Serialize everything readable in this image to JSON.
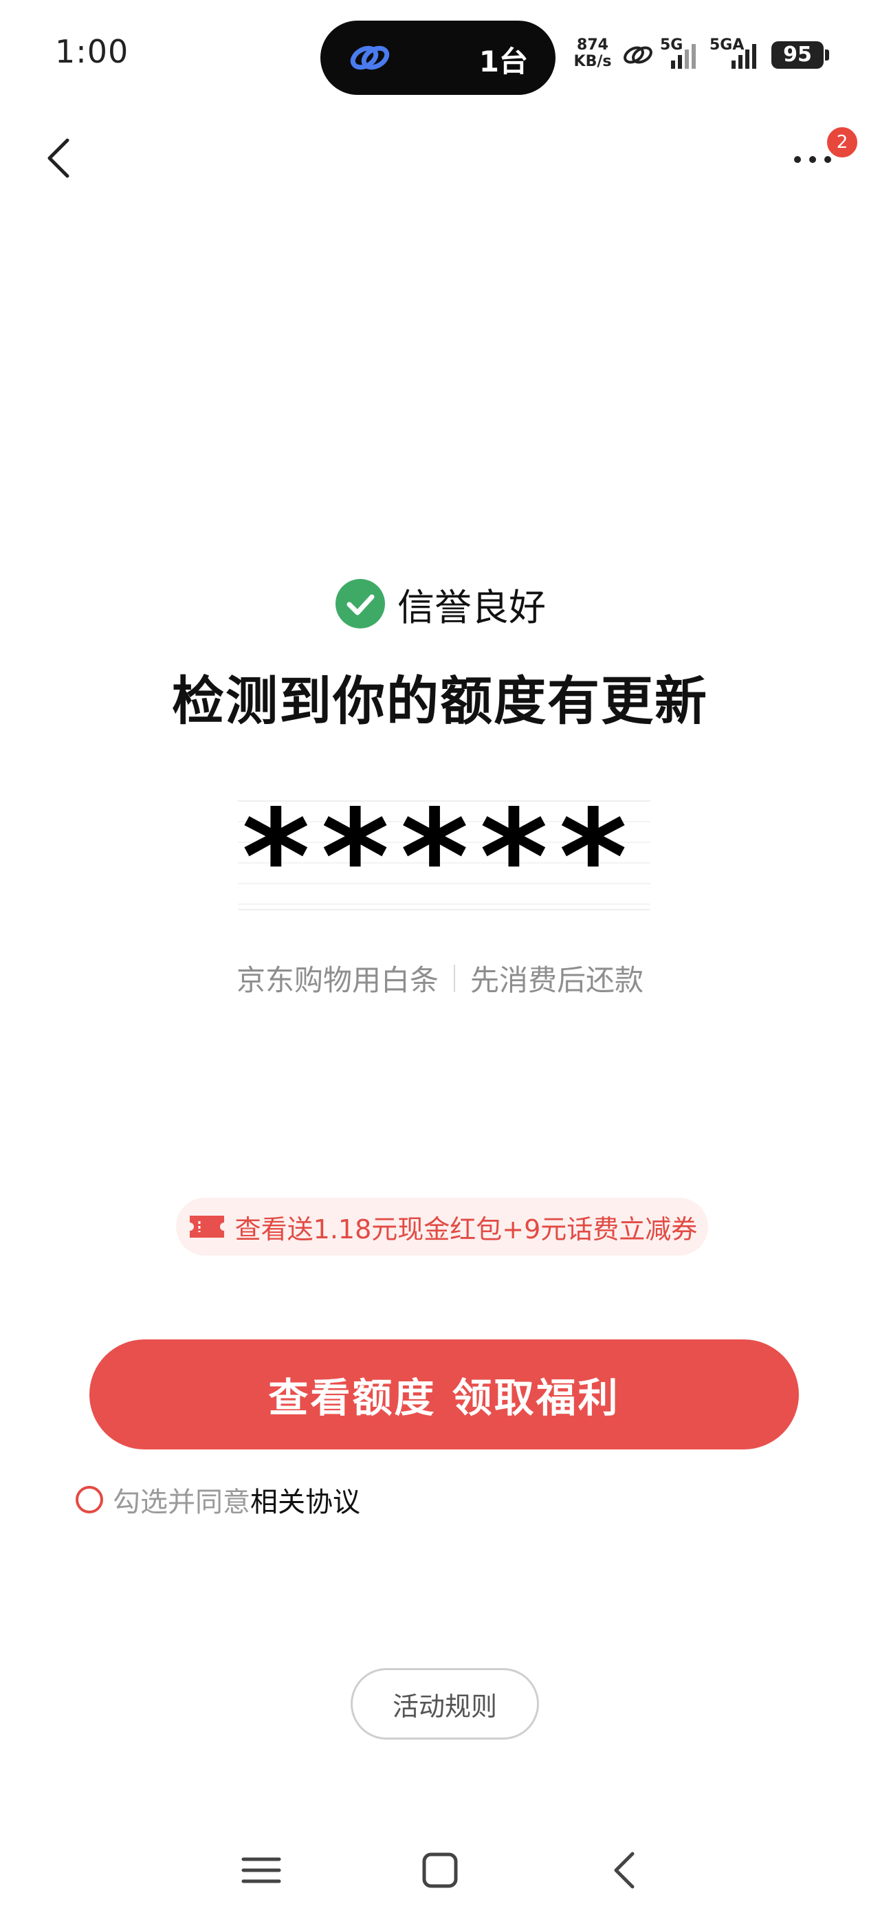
{
  "status_bar": {
    "time": "1:00",
    "island_text": "1台",
    "net_speed_value": "874",
    "net_speed_unit": "KB/s",
    "network_1": "5G",
    "network_2": "5GA",
    "battery": "95"
  },
  "nav": {
    "back_icon": "chevron-left-icon",
    "more_icon": "more-dots-icon",
    "more_badge": "2"
  },
  "main": {
    "credit_status": "信誉良好",
    "headline": "检测到你的额度有更新",
    "masked_amount": "*****",
    "subline_left": "京东购物用白条",
    "subline_right": "先消费后还款"
  },
  "promo": {
    "text": "查看送1.18元现金红包+9元话费立减券"
  },
  "cta": {
    "label": "查看额度 领取福利"
  },
  "agreement": {
    "prefix": "勾选并同意",
    "link": "相关协议"
  },
  "rules_button": {
    "label": "活动规则"
  },
  "system_nav": {
    "menu_icon": "menu-icon",
    "home_icon": "home-square-icon",
    "back_icon": "back-chevron-icon"
  },
  "colors": {
    "accent": "#e8504d",
    "check_green": "#3faa66",
    "promo_bg": "#fdf0ef"
  }
}
